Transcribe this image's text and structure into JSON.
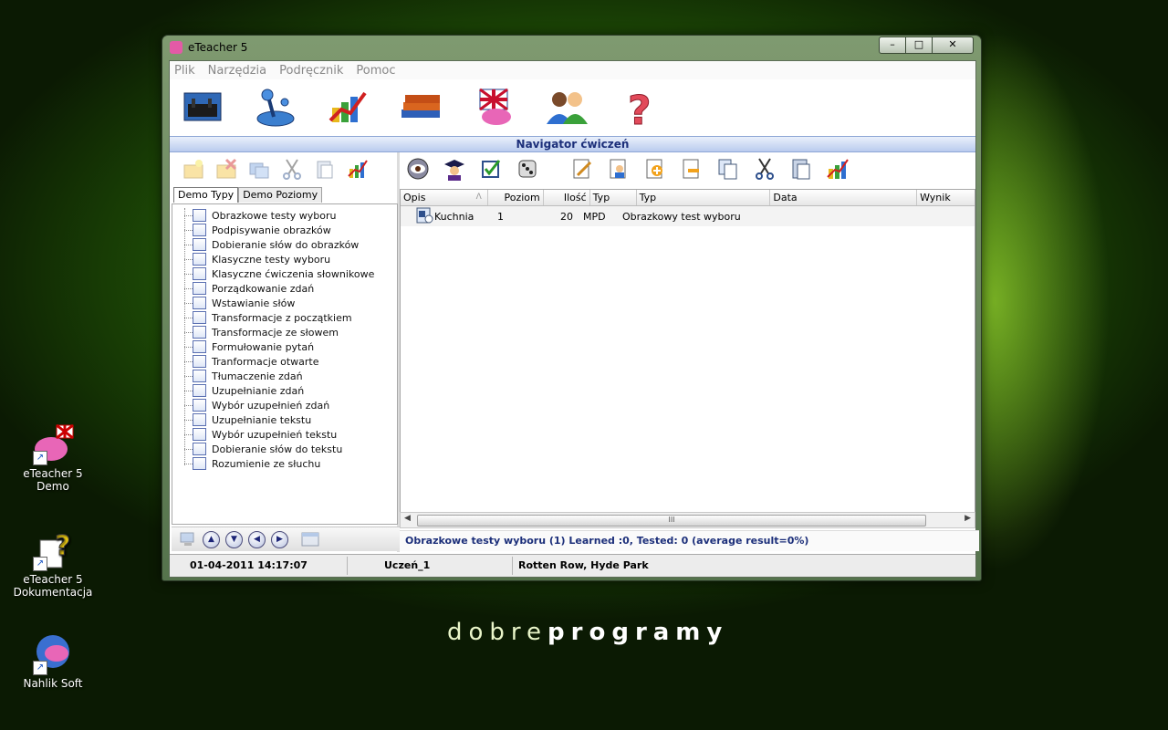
{
  "desktop": {
    "icons": [
      {
        "label": "eTeacher 5 Demo"
      },
      {
        "label": "eTeacher 5 Dokumentacja"
      },
      {
        "label": "Nahlik Soft"
      }
    ],
    "wordmark_light": "dobre",
    "wordmark_bold": "programy"
  },
  "window": {
    "title": "eTeacher 5",
    "controls": {
      "minimize": "–",
      "maximize": "□",
      "close": "✕"
    }
  },
  "menu": [
    "Plik",
    "Narzędzia",
    "Podręcznik",
    "Pomoc"
  ],
  "main_toolbar_icons": [
    "london-scene-icon",
    "joystick-icon",
    "chart-icon",
    "books-icon",
    "union-jack-icon",
    "users-icon",
    "help-icon"
  ],
  "navigator": {
    "title": "Navigator ćwiczeń"
  },
  "left": {
    "toolbar_icons": [
      "new-folder-icon",
      "delete-folder-icon",
      "copy-folder-icon",
      "cut-icon",
      "paste-icon",
      "chart-icon"
    ],
    "tabs": [
      "Demo Typy",
      "Demo Poziomy"
    ],
    "tree": [
      "Obrazkowe testy wyboru",
      "Podpisywanie obrazków",
      "Dobieranie słów do obrazków",
      "Klasyczne testy wyboru",
      "Klasyczne ćwiczenia słownikowe",
      "Porządkowanie zdań",
      "Wstawianie słów",
      "Transformacje z początkiem",
      "Transformacje ze słowem",
      "Formułowanie pytań",
      "Tranformacje otwarte",
      "Tłumaczenie zdań",
      "Uzupełnianie zdań",
      "Wybór uzupełnień zdań",
      "Uzupełnianie tekstu",
      "Wybór uzupełnień tekstu",
      "Dobieranie słów do tekstu",
      "Rozumienie ze słuchu"
    ],
    "nav_buttons": [
      "▲",
      "▼",
      "◀",
      "▶"
    ]
  },
  "right": {
    "toolbar_icons": [
      "eye-icon",
      "graduate-icon",
      "checkbox-icon",
      "dice-icon",
      "edit-icon",
      "user-doc-icon",
      "add-icon",
      "remove-icon",
      "copy-icon",
      "scissors-icon",
      "paste-icon",
      "chart-icon"
    ],
    "columns": [
      "Opis",
      "Poziom",
      "Ilość",
      "Typ",
      "Typ",
      "Data",
      "Wynik"
    ],
    "sort_indicator": "Λ",
    "rows": [
      {
        "opis": "Kuchnia",
        "poziom": "1",
        "ilosc": "20",
        "typ": "MPD",
        "typ2": "Obrazkowy test wyboru",
        "data": "",
        "wynik": ""
      }
    ],
    "scroll_grip": "III",
    "status": "Obrazkowe testy wyboru (1) Learned :0, Tested: 0 (average result=0%)"
  },
  "statusbar": {
    "datetime": "01-04-2011 14:17:07",
    "user": "Uczeń_1",
    "location": "Rotten Row, Hyde Park"
  }
}
